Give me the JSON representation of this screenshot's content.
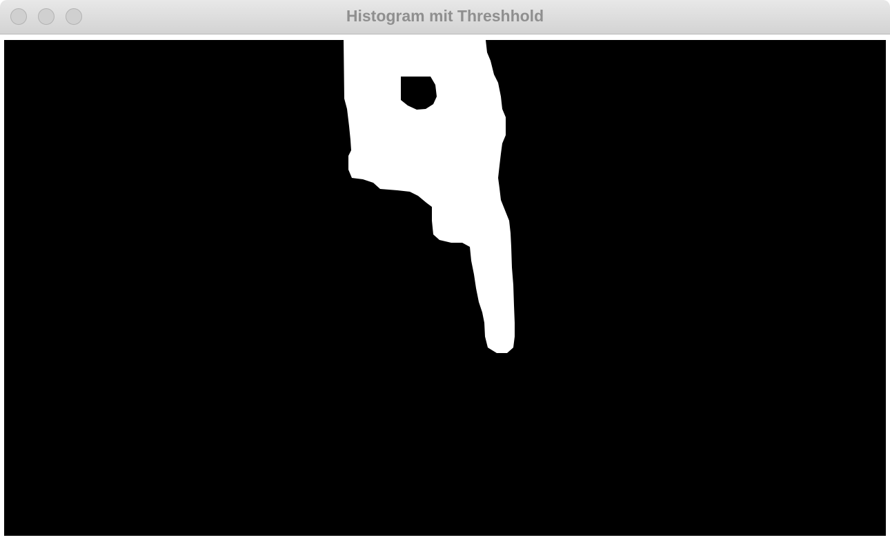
{
  "window": {
    "title": "Histogram mit Threshhold"
  },
  "canvas": {
    "background_color": "#000000",
    "blob_color": "#ffffff"
  },
  "icons": {
    "close": "traffic-light-close-icon",
    "minimize": "traffic-light-minimize-icon",
    "zoom": "traffic-light-zoom-icon"
  }
}
